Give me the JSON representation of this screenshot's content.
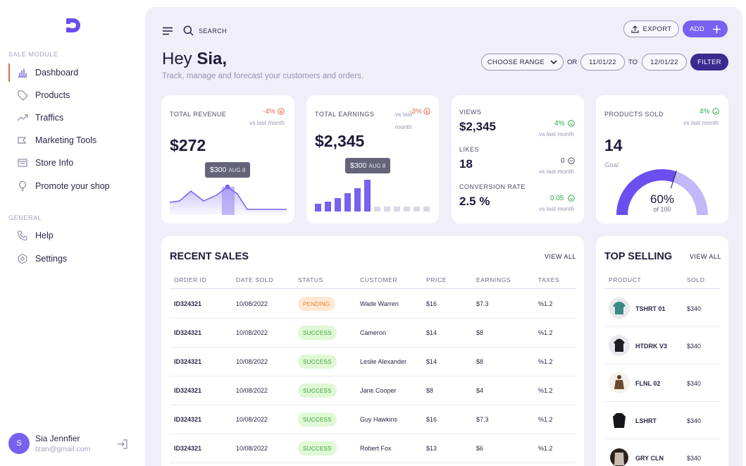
{
  "sidebar": {
    "sale_module_label": "SALE MODULE",
    "general_label": "GENERAL",
    "items": [
      {
        "label": "Dashboard",
        "icon": "bar-chart-icon"
      },
      {
        "label": "Products",
        "icon": "tag-icon"
      },
      {
        "label": "Traffics",
        "icon": "trend-icon"
      },
      {
        "label": "Marketing Tools",
        "icon": "megaphone-icon"
      },
      {
        "label": "Store Info",
        "icon": "store-icon"
      },
      {
        "label": "Promote your shop",
        "icon": "lightbulb-icon"
      }
    ],
    "general_items": [
      {
        "label": "Help",
        "icon": "phone-icon"
      },
      {
        "label": "Settings",
        "icon": "hexagon-gear-icon"
      }
    ],
    "user": {
      "initial": "S",
      "name": "Sia Jennfier",
      "email": "tzan@gmail.com"
    }
  },
  "topbar": {
    "search_label": "SEARCH",
    "export_label": "EXPORT",
    "add_label": "ADD"
  },
  "greeting": {
    "hey": "Hey ",
    "name": "Sia,",
    "subtitle": "Track, manage and forecast your customers and orders."
  },
  "range": {
    "choose_label": "CHOOSE RANGE",
    "or_label": "OR",
    "from": "11/01/22",
    "to_label": "TO",
    "to": "12/01/22",
    "filter_label": "FILTER"
  },
  "stats": {
    "revenue": {
      "label": "TOTAL REVENUE",
      "change": "-4%",
      "vs": "vs last month",
      "value": "$272",
      "tip_value": "$300",
      "tip_date": "AUG 8"
    },
    "earnings": {
      "label": "TOTAL EARNINGS",
      "change": "-3%",
      "vs_a": "vs last",
      "vs_b": "month",
      "value": "$2,345",
      "tip_value": "$300",
      "tip_date": "AUG 8"
    },
    "views": {
      "label": "VIEWS",
      "value": "$2,345",
      "change": "4%",
      "vs": "vs last month"
    },
    "likes": {
      "label": "LIKES",
      "value": "18",
      "change": "0",
      "vs": "vs last month"
    },
    "conversion": {
      "label": "CONVERSION RATE",
      "value": "2.5 %",
      "change": "0.05",
      "vs": "vs last month"
    },
    "products_sold": {
      "label": "PRODUCTS SOLD",
      "change": "4%",
      "vs": "vs last month",
      "value": "14",
      "goal_label": "Goal",
      "gauge_pct": "60%",
      "gauge_of": "of 100",
      "gauge_fraction": 0.6
    }
  },
  "recent_sales": {
    "title": "RECENT SALES",
    "view_all": "VIEW ALL",
    "columns": [
      "ORDER ID",
      "DATE SOLD",
      "STATUS",
      "CUSTOMER",
      "PRICE",
      "EARNINGS",
      "TAXES"
    ],
    "rows": [
      {
        "id": "ID324321",
        "date": "10/08/2022",
        "status": "PENDING",
        "customer": "Wade Warren",
        "price": "$16",
        "earnings": "$7.3",
        "taxes": "%1.2"
      },
      {
        "id": "ID324321",
        "date": "10/08/2022",
        "status": "SUCCESS",
        "customer": "Cameron",
        "price": "$14",
        "earnings": "$8",
        "taxes": "%1.2"
      },
      {
        "id": "ID324321",
        "date": "10/08/2022",
        "status": "SUCCESS",
        "customer": "Leslie Alexander",
        "price": "$14",
        "earnings": "$8",
        "taxes": "%1.2"
      },
      {
        "id": "ID324321",
        "date": "10/08/2022",
        "status": "SUCCESS",
        "customer": "Jane Cooper",
        "price": "$8",
        "earnings": "$4",
        "taxes": "%1.2"
      },
      {
        "id": "ID324321",
        "date": "10/08/2022",
        "status": "SUCCESS",
        "customer": "Guy Hawkins",
        "price": "$16",
        "earnings": "$7.3",
        "taxes": "%1.2"
      },
      {
        "id": "ID324321",
        "date": "10/08/2022",
        "status": "SUCCESS",
        "customer": "Robert Fox",
        "price": "$13",
        "earnings": "$6",
        "taxes": "%1.2"
      }
    ]
  },
  "top_selling": {
    "title": "TOP SELLING",
    "view_all": "VIEW ALL",
    "columns": [
      "PRODUCT",
      "SOLD"
    ],
    "rows": [
      {
        "name": "TSHRT 01",
        "sold": "$340"
      },
      {
        "name": "HTDRK V3",
        "sold": "$340"
      },
      {
        "name": "FLNL 02",
        "sold": "$340"
      },
      {
        "name": "LSHRT",
        "sold": "$340"
      },
      {
        "name": "GRY CLN",
        "sold": "$340"
      }
    ]
  },
  "colors": {
    "accent": "#7761f0",
    "dark_accent": "#3b2a8f",
    "negative": "#e46a4e",
    "positive": "#2eab4c"
  }
}
